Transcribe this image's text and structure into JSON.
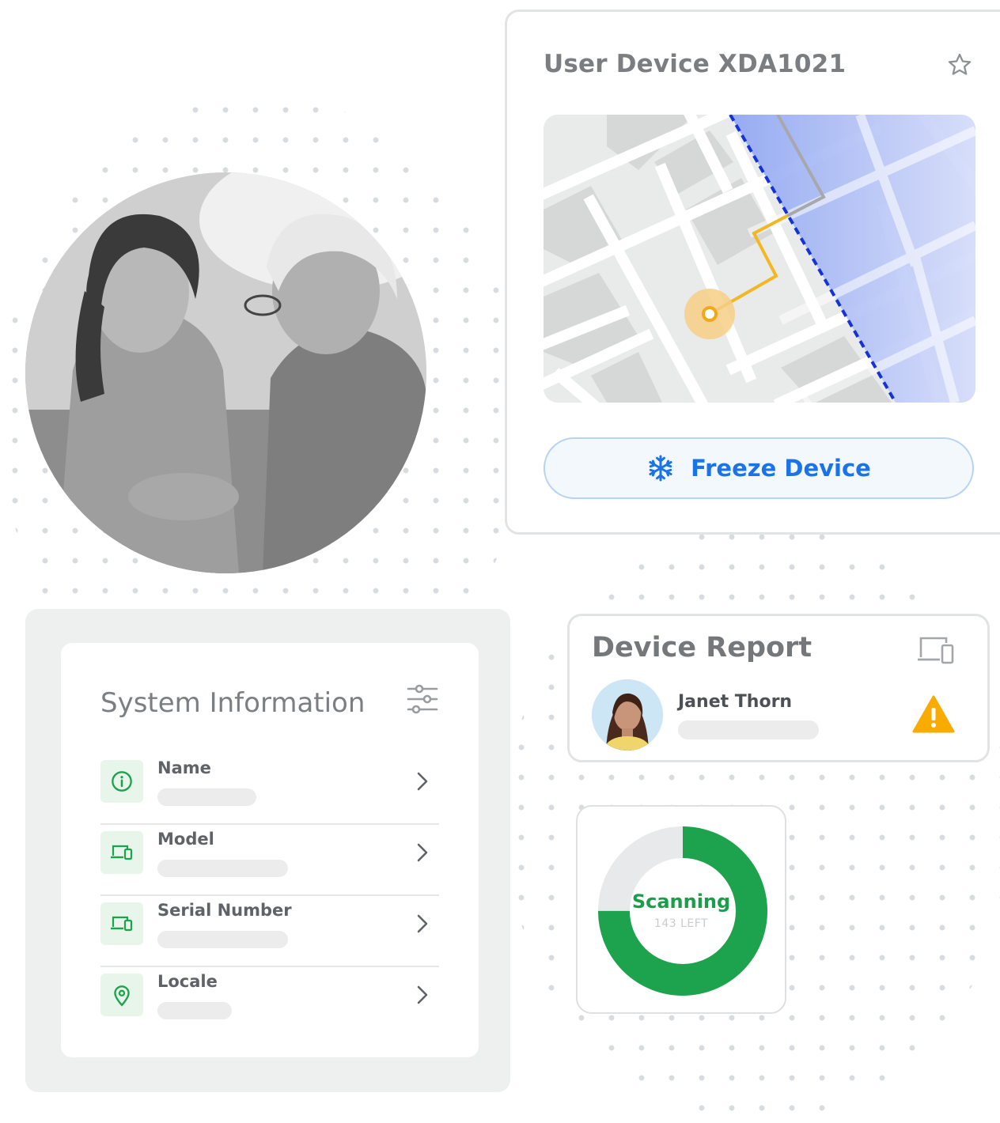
{
  "device": {
    "title": "User Device XDA1021",
    "freeze_label": "Freeze Device"
  },
  "system_info": {
    "title": "System Information",
    "rows": [
      {
        "label": "Name"
      },
      {
        "label": "Model"
      },
      {
        "label": "Serial Number"
      },
      {
        "label": "Locale"
      }
    ]
  },
  "report": {
    "title": "Device Report",
    "user_name": "Janet Thorn"
  },
  "scan": {
    "status": "Scanning",
    "remaining": "143 LEFT",
    "progress_fraction": 0.75
  },
  "colors": {
    "accent_blue": "#1a73e8",
    "accent_green": "#1da34d",
    "warning": "#f9ab00",
    "route": "#f3b724"
  },
  "icons": {
    "star": "star-icon",
    "freeze": "snowflake-icon",
    "filters": "sliders-icon",
    "name_row": "info-icon",
    "model_row": "devices-icon",
    "serial_row": "devices-icon",
    "locale_row": "location-pin-icon",
    "report_header": "devices-icon",
    "report_alert": "warning-icon"
  }
}
